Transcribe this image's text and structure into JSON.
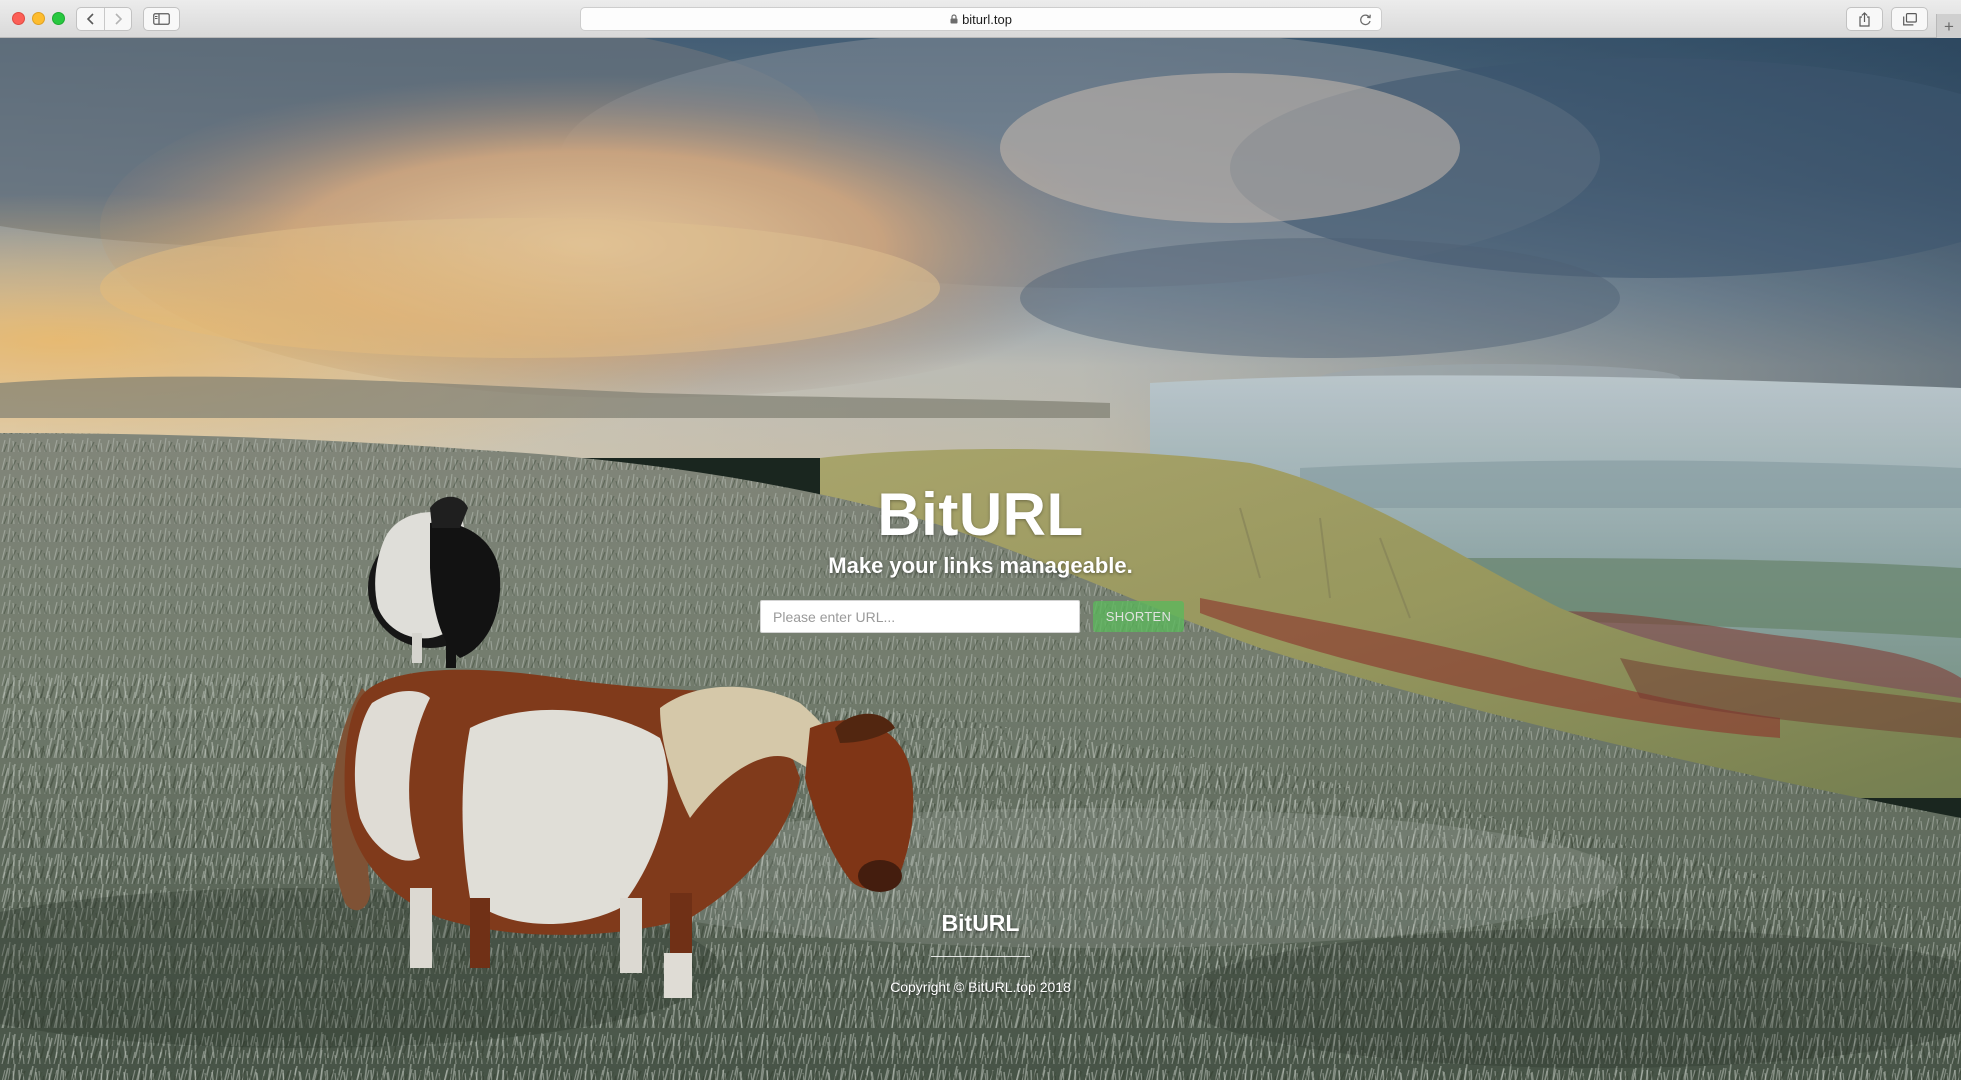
{
  "browser": {
    "url": "biturl.top"
  },
  "hero": {
    "title": "BitURL",
    "subtitle": "Make your links manageable.",
    "input_placeholder": "Please enter URL...",
    "input_value": "",
    "shorten_label": "SHORTEN"
  },
  "footer": {
    "brand": "BitURL",
    "copyright": "Copyright © BitURL.top 2018"
  },
  "colors": {
    "shorten_button": "#5cb85c",
    "text": "#ffffff"
  }
}
